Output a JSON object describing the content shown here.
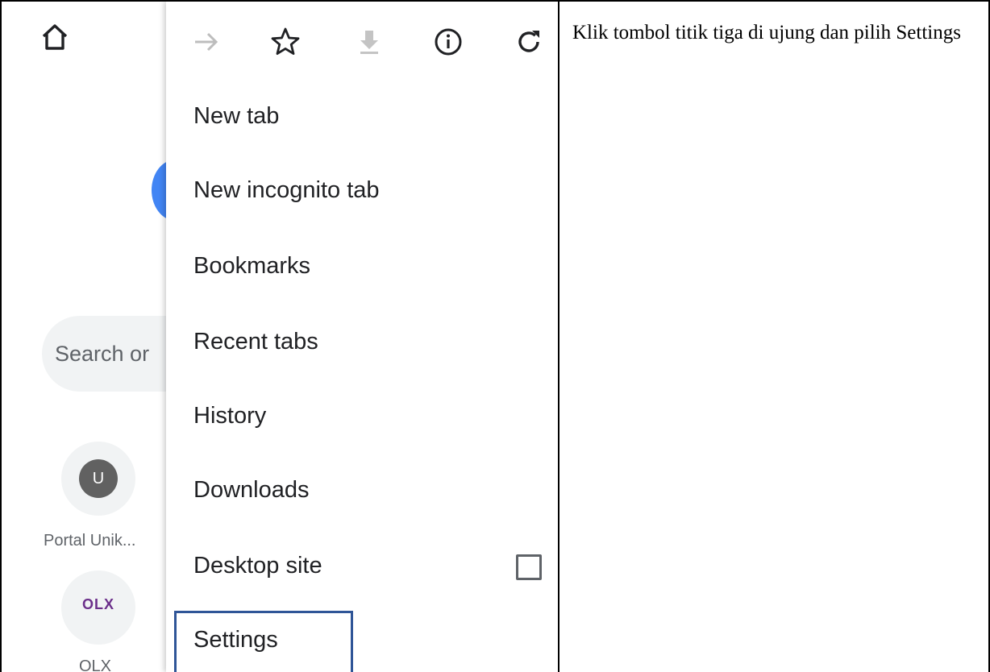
{
  "background_page": {
    "search_text": "Search or",
    "tiles": [
      {
        "avatar_letter": "U",
        "label": "Portal Unik..."
      },
      {
        "logo_text": "OLX",
        "label": "OLX"
      }
    ]
  },
  "menu": {
    "toolbar_icons": [
      "forward-arrow-icon",
      "star-icon",
      "download-icon",
      "info-icon",
      "reload-icon"
    ],
    "items": [
      {
        "label": "New tab"
      },
      {
        "label": "New incognito tab"
      },
      {
        "label": "Bookmarks"
      },
      {
        "label": "Recent tabs"
      },
      {
        "label": "History"
      },
      {
        "label": "Downloads"
      },
      {
        "label": "Desktop site",
        "checkbox_checked": false
      },
      {
        "label": "Settings",
        "highlighted": true
      }
    ],
    "highlight_color": "#2f5597"
  },
  "instruction": {
    "text": "Klik tombol titik tiga di ujung dan pilih Settings"
  }
}
